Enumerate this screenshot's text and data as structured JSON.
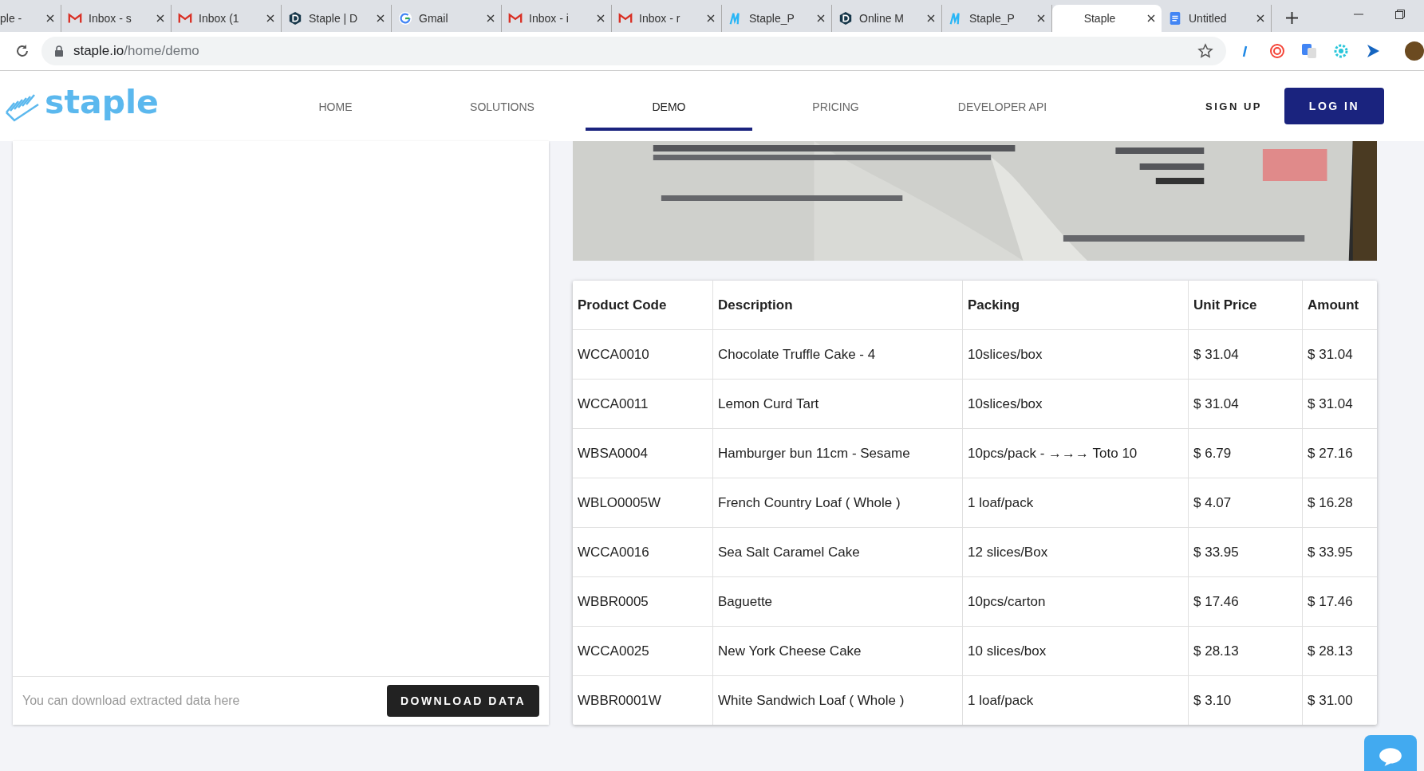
{
  "browser": {
    "tabs": [
      {
        "title": "ple - ",
        "kind": "plain",
        "selected": false
      },
      {
        "title": "Inbox - s",
        "kind": "mail",
        "selected": false
      },
      {
        "title": "Inbox (1",
        "kind": "mail",
        "selected": false
      },
      {
        "title": "Staple | D",
        "kind": "dark-d",
        "selected": false
      },
      {
        "title": "Gmail",
        "kind": "google",
        "selected": false
      },
      {
        "title": "Inbox - i",
        "kind": "mail",
        "selected": false
      },
      {
        "title": "Inbox - r",
        "kind": "mail",
        "selected": false
      },
      {
        "title": "Staple_P",
        "kind": "script-m",
        "selected": false
      },
      {
        "title": "Online M",
        "kind": "dark-d",
        "selected": false
      },
      {
        "title": "Staple_P",
        "kind": "script-m",
        "selected": false
      },
      {
        "title": "Staple",
        "kind": "plain",
        "selected": true
      },
      {
        "title": "Untitled",
        "kind": "doc",
        "selected": false
      }
    ],
    "url_host": "staple.io",
    "url_path": "/home/demo"
  },
  "site": {
    "logo": "staple",
    "nav": [
      {
        "label": "HOME",
        "selected": false
      },
      {
        "label": "SOLUTIONS",
        "selected": false
      },
      {
        "label": "DEMO",
        "selected": true
      },
      {
        "label": "PRICING",
        "selected": false
      },
      {
        "label": "DEVELOPER API",
        "selected": false
      }
    ],
    "sign_up": "SIGN UP",
    "log_in": "LOG IN"
  },
  "download": {
    "text": "You can download extracted data here",
    "button": "DOWNLOAD DATA"
  },
  "table": {
    "columns": [
      "Product Code",
      "Description",
      "Packing",
      "Unit Price",
      "Amount"
    ],
    "rows": [
      [
        "WCCA0010",
        "Chocolate Truffle Cake - 4",
        "10slices/box",
        "$ 31.04",
        "$ 31.04"
      ],
      [
        "WCCA0011",
        "Lemon Curd Tart",
        "10slices/box",
        "$ 31.04",
        "$ 31.04"
      ],
      [
        "WBSA0004",
        "Hamburger bun 11cm - Sesame",
        "10pcs/pack - →→→ Toto 10",
        "$ 6.79",
        "$ 27.16"
      ],
      [
        "WBLO0005W",
        "French Country Loaf ( Whole )",
        "1 loaf/pack",
        "$ 4.07",
        "$ 16.28"
      ],
      [
        "WCCA0016",
        "Sea Salt Caramel Cake",
        "12 slices/Box",
        "$ 33.95",
        "$ 33.95"
      ],
      [
        "WBBR0005",
        "Baguette",
        "10pcs/carton",
        "$ 17.46",
        "$ 17.46"
      ],
      [
        "WCCA0025",
        "New York Cheese Cake",
        "10 slices/box",
        "$ 28.13",
        "$ 28.13"
      ],
      [
        "WBBR0001W",
        "White Sandwich Loaf ( Whole )",
        "1 loaf/pack",
        "$ 3.10",
        "$ 31.00"
      ]
    ]
  }
}
